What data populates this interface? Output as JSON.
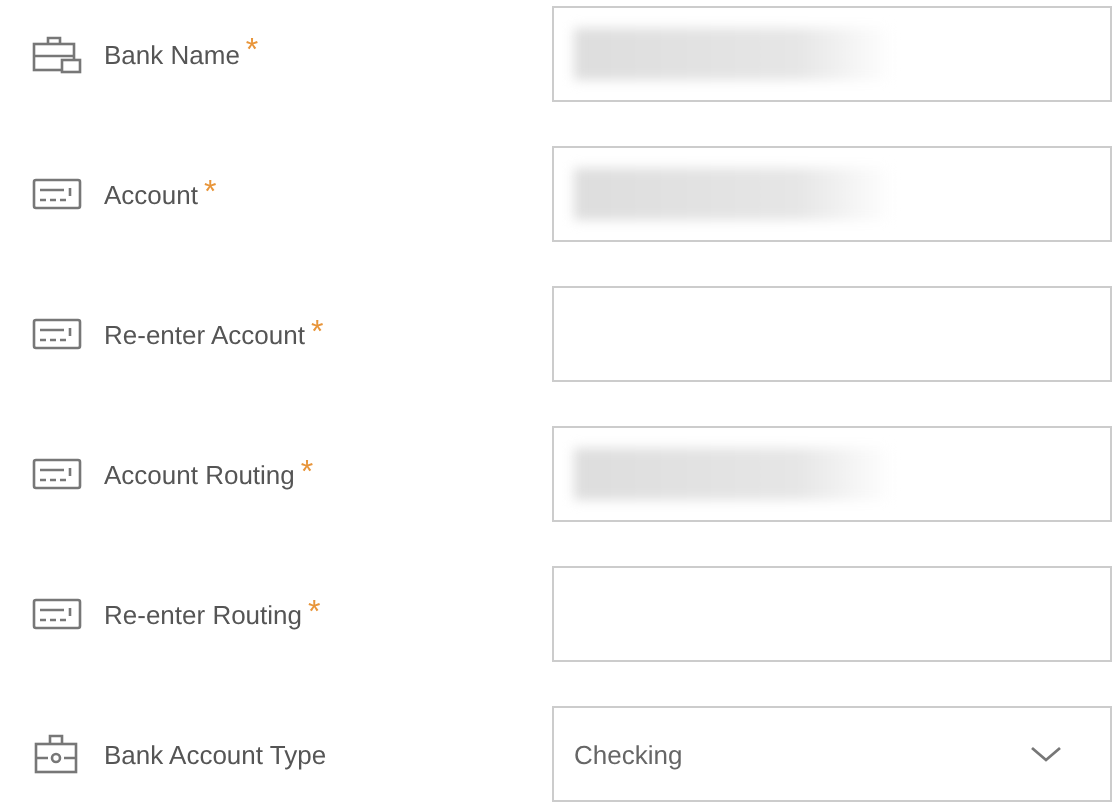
{
  "fields": [
    {
      "kind": "text",
      "label": "Bank Name",
      "required_mark": "*",
      "redacted": true
    },
    {
      "kind": "number",
      "label": "Account",
      "required_mark": "*",
      "redacted": true
    },
    {
      "kind": "number",
      "label": "Re-enter Account",
      "required_mark": "*",
      "redacted": false
    },
    {
      "kind": "number",
      "label": "Account Routing",
      "required_mark": "*",
      "redacted": true
    },
    {
      "kind": "number",
      "label": "Re-enter Routing",
      "required_mark": "*",
      "redacted": false
    },
    {
      "kind": "select",
      "label": "Bank Account Type",
      "value": "Checking"
    }
  ]
}
